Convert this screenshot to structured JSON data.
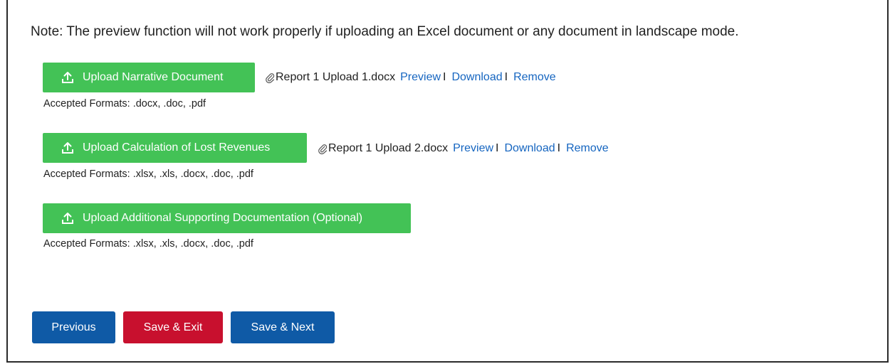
{
  "note": "Note: The preview function will not work properly if uploading an Excel document or any document in landscape mode.",
  "uploads": [
    {
      "button_label": "Upload Narrative Document",
      "file_name": "Report 1 Upload 1.docx",
      "preview_label": "Preview",
      "download_label": "Download",
      "remove_label": "Remove",
      "formats": "Accepted Formats: .docx, .doc, .pdf"
    },
    {
      "button_label": "Upload Calculation of Lost Revenues",
      "file_name": "Report 1 Upload 2.docx",
      "preview_label": "Preview",
      "download_label": "Download",
      "remove_label": "Remove",
      "formats": "Accepted Formats: .xlsx, .xls, .docx, .doc, .pdf"
    },
    {
      "button_label": "Upload Additional Supporting Documentation (Optional)",
      "formats": "Accepted Formats: .xlsx, .xls, .docx, .doc, .pdf"
    }
  ],
  "separator": "I",
  "nav": {
    "previous_label": "Previous",
    "save_exit_label": "Save & Exit",
    "save_next_label": "Save & Next"
  },
  "colors": {
    "upload_green": "#43c256",
    "link_blue": "#1565c0",
    "nav_blue": "#0f5aa6",
    "exit_red": "#c8102e"
  },
  "icons": {
    "upload": "upload-icon",
    "attachment": "paperclip-icon"
  }
}
